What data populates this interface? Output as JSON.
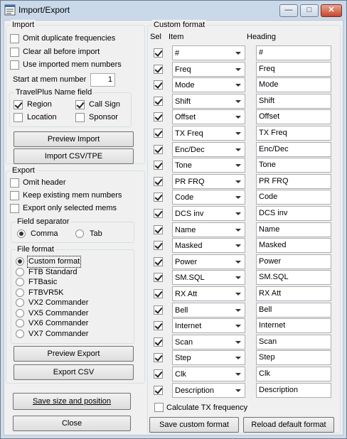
{
  "window": {
    "title": "Import/Export"
  },
  "import": {
    "group_label": "Import",
    "omit_duplicates": {
      "label": "Omit duplicate frequencies",
      "checked": false
    },
    "clear_all": {
      "label": "Clear all before import",
      "checked": false
    },
    "use_imported": {
      "label": "Use imported mem numbers",
      "checked": false
    },
    "start_label": "Start at mem number",
    "start_value": "1",
    "travelplus": {
      "label": "TravelPlus Name field",
      "region": {
        "label": "Region",
        "checked": true
      },
      "callsign": {
        "label": "Call Sign",
        "checked": true
      },
      "location": {
        "label": "Location",
        "checked": false
      },
      "sponsor": {
        "label": "Sponsor",
        "checked": false
      }
    },
    "preview_label": "Preview Import",
    "import_label": "Import CSV/TPE"
  },
  "export": {
    "group_label": "Export",
    "omit_header": {
      "label": "Omit header",
      "checked": false
    },
    "keep_existing": {
      "label": "Keep existing mem numbers",
      "checked": false
    },
    "only_selected": {
      "label": "Export only selected mems",
      "checked": false
    },
    "separator": {
      "label": "Field separator",
      "comma": {
        "label": "Comma",
        "selected": true
      },
      "tab": {
        "label": "Tab",
        "selected": false
      }
    },
    "file_format": {
      "label": "File format",
      "options": [
        "Custom format",
        "FTB Standard",
        "FTBasic",
        "FTBVR5K",
        "VX2 Commander",
        "VX5 Commander",
        "VX6 Commander",
        "VX7 Commander"
      ],
      "selected_index": 0
    },
    "preview_label": "Preview Export",
    "export_label": "Export CSV"
  },
  "footer": {
    "save_size_label": "Save size and position",
    "close_label": "Close"
  },
  "custom": {
    "group_label": "Custom format",
    "col_sel": "Sel",
    "col_item": "Item",
    "col_heading": "Heading",
    "rows": [
      {
        "item": "#",
        "heading": "#",
        "sel": true
      },
      {
        "item": "Freq",
        "heading": "Freq",
        "sel": true
      },
      {
        "item": "Mode",
        "heading": "Mode",
        "sel": true
      },
      {
        "item": "Shift",
        "heading": "Shift",
        "sel": true
      },
      {
        "item": "Offset",
        "heading": "Offset",
        "sel": true
      },
      {
        "item": "TX Freq",
        "heading": "TX Freq",
        "sel": true
      },
      {
        "item": "Enc/Dec",
        "heading": "Enc/Dec",
        "sel": true
      },
      {
        "item": "Tone",
        "heading": "Tone",
        "sel": true
      },
      {
        "item": "PR FRQ",
        "heading": "PR FRQ",
        "sel": true
      },
      {
        "item": "Code",
        "heading": "Code",
        "sel": true
      },
      {
        "item": "DCS inv",
        "heading": "DCS inv",
        "sel": true
      },
      {
        "item": "Name",
        "heading": "Name",
        "sel": true
      },
      {
        "item": "Masked",
        "heading": "Masked",
        "sel": true
      },
      {
        "item": "Power",
        "heading": "Power",
        "sel": true
      },
      {
        "item": "SM.SQL",
        "heading": "SM.SQL",
        "sel": true
      },
      {
        "item": "RX Att",
        "heading": "RX Att",
        "sel": true
      },
      {
        "item": "Bell",
        "heading": "Bell",
        "sel": true
      },
      {
        "item": "Internet",
        "heading": "Internet",
        "sel": true
      },
      {
        "item": "Scan",
        "heading": "Scan",
        "sel": true
      },
      {
        "item": "Step",
        "heading": "Step",
        "sel": true
      },
      {
        "item": "Clk",
        "heading": "Clk",
        "sel": true
      },
      {
        "item": "Description",
        "heading": "Description",
        "sel": true
      }
    ],
    "calc_tx": {
      "label": "Calculate TX frequency",
      "checked": false
    },
    "save_label": "Save custom format",
    "reload_label": "Reload default format"
  }
}
